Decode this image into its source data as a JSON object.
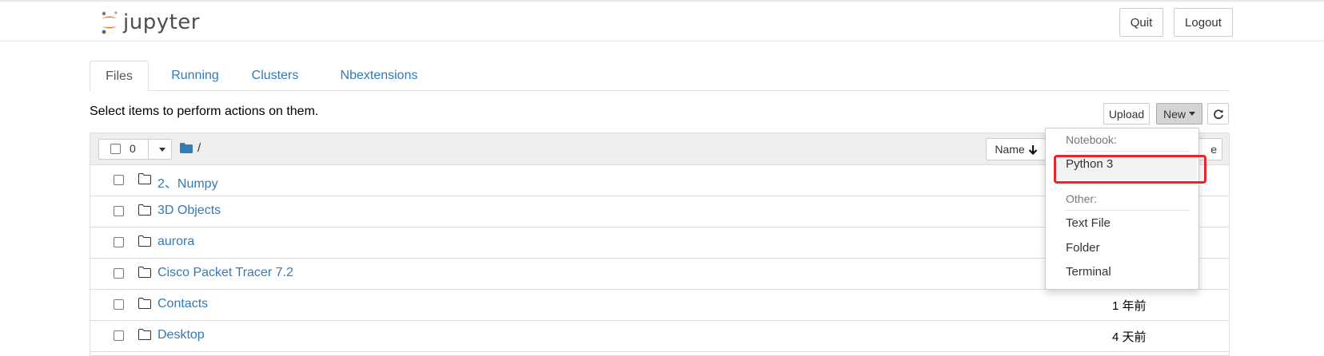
{
  "app": {
    "logo_text": "jupyter"
  },
  "header": {
    "quit_label": "Quit",
    "logout_label": "Logout"
  },
  "tabs": [
    {
      "label": "Files",
      "active": true
    },
    {
      "label": "Running",
      "active": false
    },
    {
      "label": "Clusters",
      "active": false
    },
    {
      "label": "Nbextensions",
      "active": false
    }
  ],
  "toolbar": {
    "instructions": "Select items to perform actions on them.",
    "upload_label": "Upload",
    "new_label": "New"
  },
  "list_header": {
    "selected_count": "0",
    "path": "/",
    "sort_name_label": "Name",
    "sort_modified_partial": "e"
  },
  "files": [
    {
      "name": "2、Numpy",
      "modified": ""
    },
    {
      "name": "3D Objects",
      "modified": ""
    },
    {
      "name": "aurora",
      "modified": ""
    },
    {
      "name": "Cisco Packet Tracer 7.2",
      "modified": ""
    },
    {
      "name": "Contacts",
      "modified": "1 年前"
    },
    {
      "name": "Desktop",
      "modified": "4 天前"
    }
  ],
  "new_menu": {
    "notebook_header": "Notebook:",
    "python3": "Python 3",
    "other_header": "Other:",
    "text_file": "Text File",
    "folder": "Folder",
    "terminal": "Terminal"
  },
  "colors": {
    "link": "#337ab7",
    "highlight": "#e8242d",
    "logo_orange": "#f37726"
  }
}
